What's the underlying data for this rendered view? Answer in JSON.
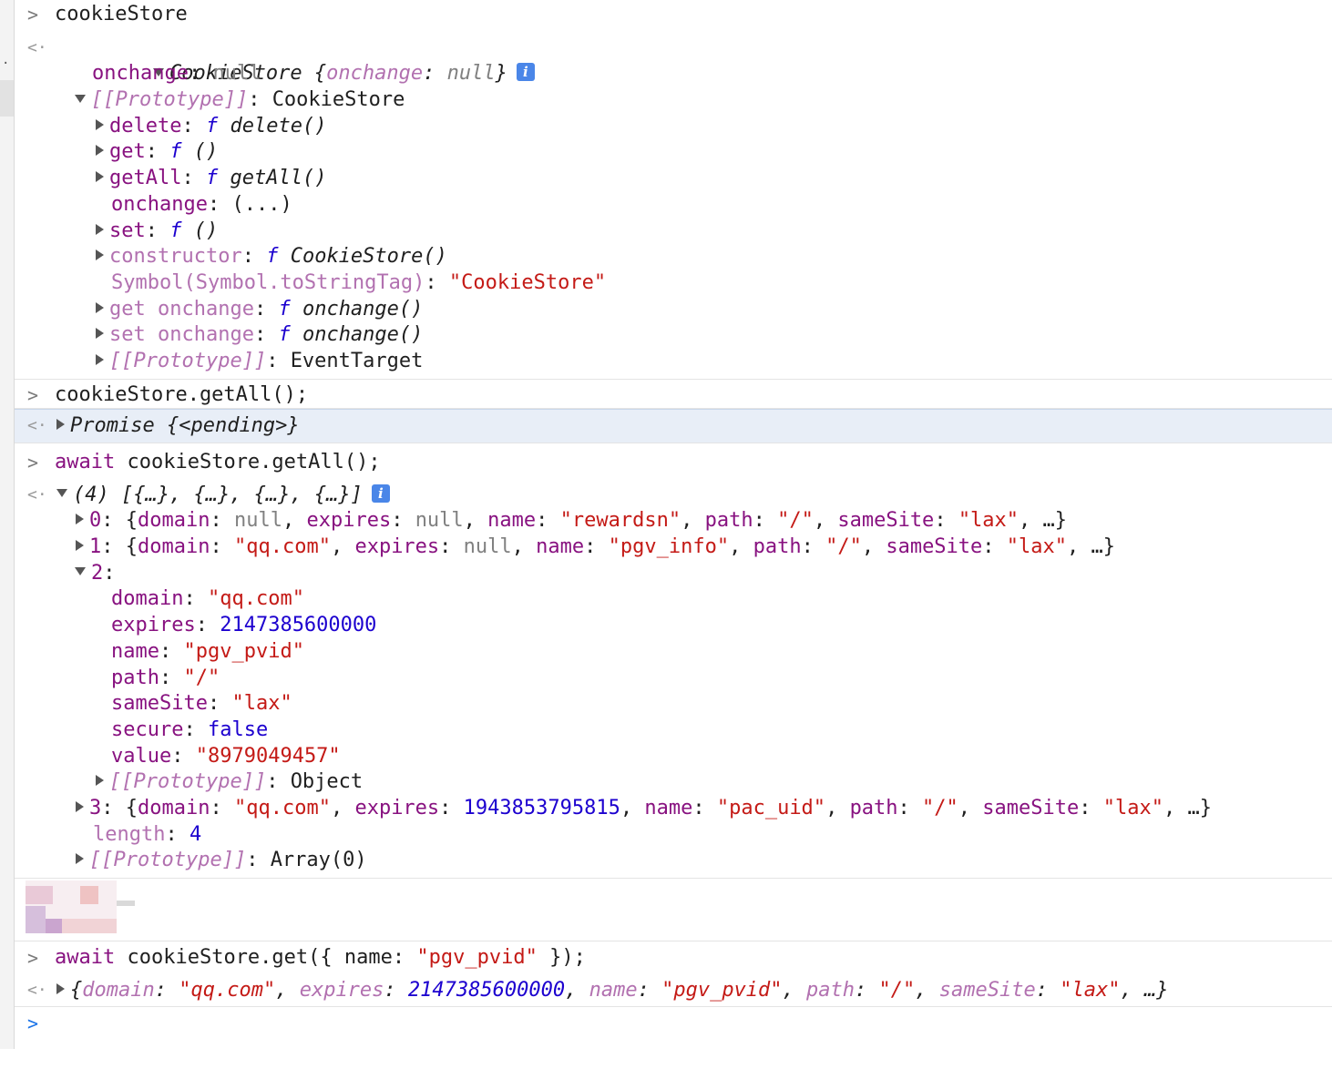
{
  "gutter_mark": ".",
  "input1": "cookieStore",
  "out1": {
    "head_name": "CookieStore",
    "head_open": "{",
    "head_key": "onchange",
    "head_val": "null",
    "head_close": "}",
    "info_icon": "i",
    "onchange_key": "onchange",
    "onchange_val": "null",
    "proto_key": "[[Prototype]]",
    "proto_val": "CookieStore",
    "members": {
      "delete_key": "delete",
      "delete_fn": "delete()",
      "get_key": "get",
      "get_fn": "()",
      "getall_key": "getAll",
      "getall_fn": "getAll()",
      "onchange_key": "onchange",
      "onchange_val": "(...)",
      "set_key": "set",
      "set_fn": "()",
      "ctor_key": "constructor",
      "ctor_fn": "CookieStore()",
      "symbol_key": "Symbol(Symbol.toStringTag)",
      "symbol_val": "\"CookieStore\"",
      "getonchange_key": "get onchange",
      "getonchange_fn": "onchange()",
      "setonchange_key": "set onchange",
      "setonchange_fn": "onchange()",
      "proto2_key": "[[Prototype]]",
      "proto2_val": "EventTarget"
    },
    "f_glyph": "f"
  },
  "input2": "cookieStore.getAll();",
  "out2": {
    "name": "Promise",
    "pending": "{<pending>}"
  },
  "input3": {
    "await": "await",
    "rest": "cookieStore.getAll();"
  },
  "out3": {
    "head": "(4) [{…}, {…}, {…}, {…}]",
    "row0": {
      "idx": "0",
      "domain": "null",
      "expires": "null",
      "name": "\"rewardsn\"",
      "path": "\"/\"",
      "samesite": "\"lax\""
    },
    "row1": {
      "idx": "1",
      "domain": "\"qq.com\"",
      "expires": "null",
      "name": "\"pgv_info\"",
      "path": "\"/\"",
      "samesite": "\"lax\""
    },
    "row2": {
      "idx": "2",
      "domain": "\"qq.com\"",
      "expires": "2147385600000",
      "name": "\"pgv_pvid\"",
      "path": "\"/\"",
      "samesite": "\"lax\"",
      "secure": "false",
      "value": "\"8979049457\"",
      "proto_key": "[[Prototype]]",
      "proto_val": "Object"
    },
    "row3": {
      "idx": "3",
      "domain": "\"qq.com\"",
      "expires": "1943853795815",
      "name": "\"pac_uid\"",
      "path": "\"/\"",
      "samesite": "\"lax\""
    },
    "length_key": "length",
    "length_val": "4",
    "proto_key": "[[Prototype]]",
    "proto_val": "Array(0)"
  },
  "labels": {
    "domain": "domain",
    "expires": "expires",
    "name": "name",
    "path": "path",
    "samesite": "sameSite",
    "secure": "secure",
    "value": "value",
    "ellipsis": "…"
  },
  "input4": {
    "await": "await",
    "call": "cookieStore.get({ name: ",
    "arg": "\"pgv_pvid\"",
    "close": " });"
  },
  "out4": {
    "domain": "\"qq.com\"",
    "expires": "2147385600000",
    "name": "\"pgv_pvid\"",
    "path": "\"/\"",
    "samesite": "\"lax\""
  },
  "prompt_glyph": ">",
  "return_glyph": "<·"
}
